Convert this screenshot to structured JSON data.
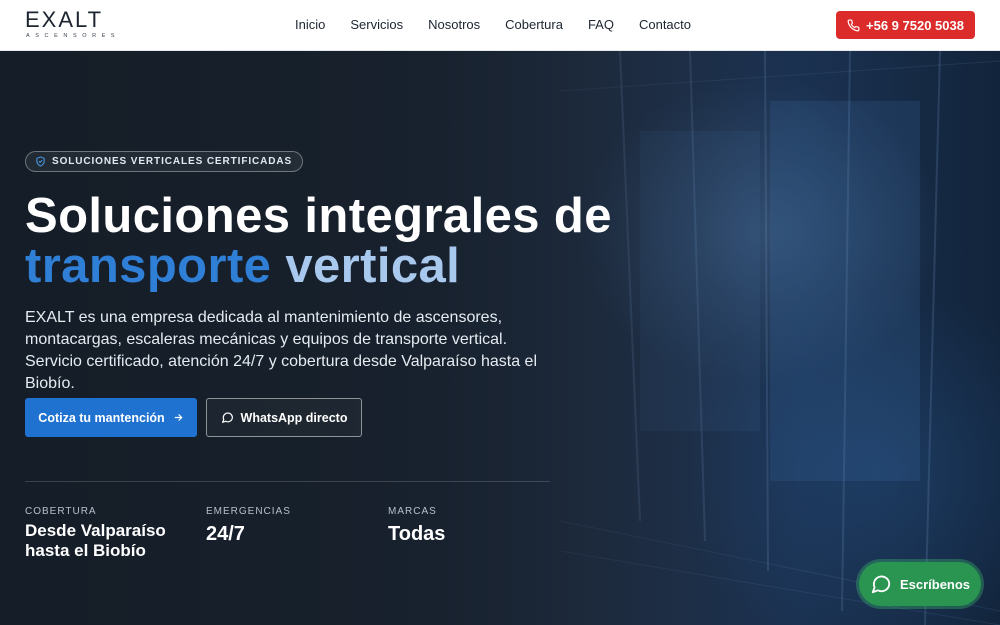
{
  "brand": {
    "name": "EXALT",
    "subtitle": "ASCENSORES"
  },
  "nav": {
    "items": [
      "Inicio",
      "Servicios",
      "Nosotros",
      "Cobertura",
      "FAQ",
      "Contacto"
    ]
  },
  "header": {
    "phone_label": "+56 9 7520 5038",
    "phone_icon": "phone-icon"
  },
  "hero": {
    "badge": "SOLUCIONES VERTICALES CERTIFICADAS",
    "title_line1": "Soluciones integrales de",
    "title_line2_a": "transporte",
    "title_line2_b": "vertical",
    "description": "EXALT es una empresa dedicada al mantenimiento de ascensores, montacargas, escaleras mecánicas y equipos de transporte vertical. Servicio certificado, atención 24/7 y cobertura desde Valparaíso hasta el Biobío.",
    "primary_button": "Cotiza tu mantención",
    "secondary_button": "WhatsApp directo"
  },
  "stats": [
    {
      "label": "COBERTURA",
      "value": "Desde Valparaíso hasta el Biobío"
    },
    {
      "label": "EMERGENCIAS",
      "value": "24/7"
    },
    {
      "label": "MARCAS",
      "value": "Todas"
    }
  ],
  "chat": {
    "label": "Escríbenos"
  },
  "colors": {
    "accent_blue": "#1f72cf",
    "phone_red": "#dc2b2b",
    "chat_green": "#2a9451",
    "title_light_blue": "#a8c8ee"
  }
}
